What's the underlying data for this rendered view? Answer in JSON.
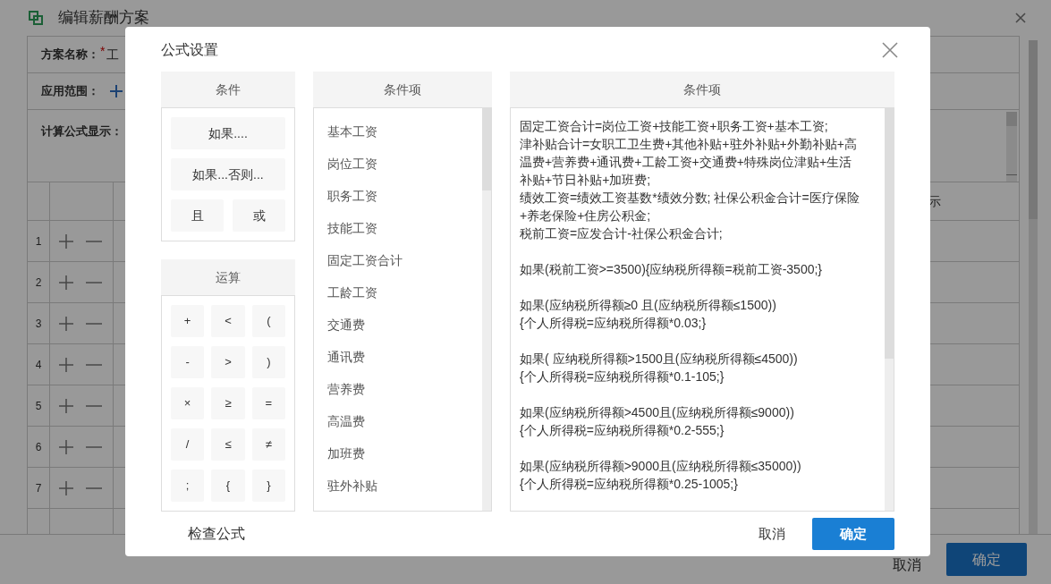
{
  "page": {
    "title": "编辑薪酬方案",
    "fields": [
      {
        "kind": "text",
        "label": "方案名称：",
        "required_mark": "*",
        "value": "工"
      },
      {
        "kind": "add",
        "label": "应用范围："
      },
      {
        "kind": "textarea",
        "label": "计算公式显示："
      }
    ],
    "table": {
      "column_header": "示",
      "rows": [
        "1",
        "2",
        "3",
        "4",
        "5",
        "6",
        "7"
      ]
    },
    "footer": {
      "cancel": "取消",
      "confirm": "确定"
    }
  },
  "dialog": {
    "title": "公式设置",
    "conditions": {
      "header": "条件",
      "buttons": [
        "如果....",
        "如果...否则...",
        "且",
        "或"
      ]
    },
    "operations": {
      "header": "运算",
      "buttons": [
        "+",
        "<",
        "(",
        "-",
        ">",
        ")",
        "×",
        "≥",
        "=",
        "/",
        "≤",
        "≠",
        ";",
        "{",
        "}"
      ]
    },
    "items": {
      "header": "条件项",
      "list": [
        "基本工资",
        "岗位工资",
        "职务工资",
        "技能工资",
        "固定工资合计",
        "工龄工资",
        "交通费",
        "通讯费",
        "营养费",
        "高温费",
        "加班费",
        "驻外补贴"
      ]
    },
    "formula": {
      "header": "条件项",
      "blocks": [
        [
          "固定工资合计=岗位工资+技能工资+职务工资+基本工资;",
          "津补贴合计=女职工卫生费+其他补贴+驻外补贴+外勤补贴+高",
          "温费+营养费+通讯费+工龄工资+交通费+特殊岗位津贴+生活",
          "补贴+节日补贴+加班费;",
          "绩效工资=绩效工资基数*绩效分数; 社保公积金合计=医疗保险",
          "+养老保险+住房公积金;",
          "税前工资=应发合计-社保公积金合计;"
        ],
        [
          "如果(税前工资>=3500){应纳税所得额=税前工资-3500;}"
        ],
        [
          "如果(应纳税所得额≥0 且(应纳税所得额≤1500))",
          "{个人所得税=应纳税所得额*0.03;}"
        ],
        [
          "如果( 应纳税所得额>1500且(应纳税所得额≤4500))",
          "{个人所得税=应纳税所得额*0.1-105;}"
        ],
        [
          "如果(应纳税所得额>4500且(应纳税所得额≤9000))",
          "{个人所得税=应纳税所得额*0.2-555;}"
        ],
        [
          "如果(应纳税所得额>9000且(应纳税所得额≤35000))",
          "{个人所得税=应纳税所得额*0.25-1005;}"
        ]
      ]
    },
    "check": "检查公式",
    "cancel": "取消",
    "confirm": "确定"
  }
}
